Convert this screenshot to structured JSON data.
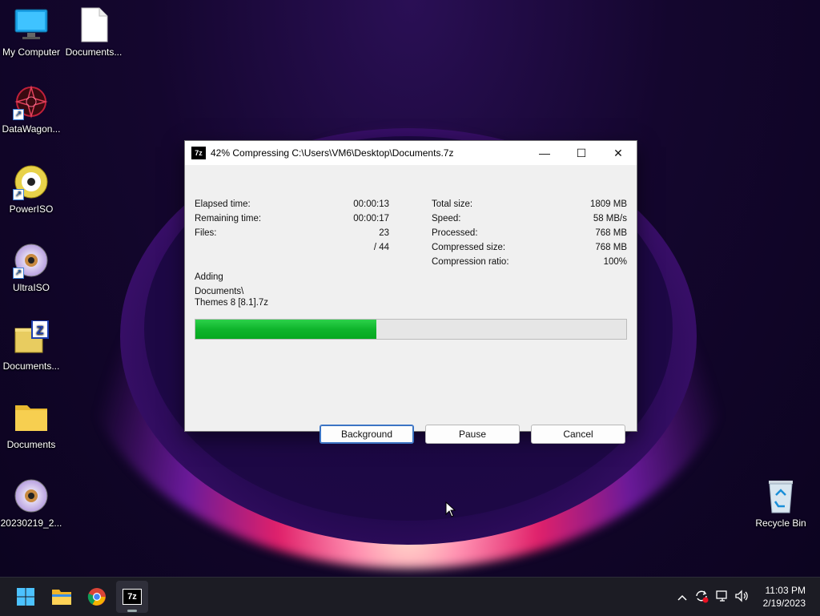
{
  "desktop": {
    "icons": [
      {
        "label": "My Computer"
      },
      {
        "label": "Documents..."
      },
      {
        "label": "DataWagon..."
      },
      {
        "label": "PowerISO"
      },
      {
        "label": "UltraISO"
      },
      {
        "label": "Documents..."
      },
      {
        "label": "Documents"
      },
      {
        "label": "20230219_2..."
      },
      {
        "label": "Recycle Bin"
      }
    ]
  },
  "dialog": {
    "app_icon": "7z",
    "title": "42% Compressing C:\\Users\\VM6\\Desktop\\Documents.7z",
    "stats_left": [
      {
        "label": "Elapsed time:",
        "value": "00:00:13"
      },
      {
        "label": "Remaining time:",
        "value": "00:00:17"
      },
      {
        "label": "Files:",
        "value": "23"
      },
      {
        "label": "",
        "value": "/ 44"
      }
    ],
    "stats_right": [
      {
        "label": "Total size:",
        "value": "1809 MB"
      },
      {
        "label": "Speed:",
        "value": "58 MB/s"
      },
      {
        "label": "Processed:",
        "value": "768 MB"
      },
      {
        "label": "Compressed size:",
        "value": "768 MB"
      },
      {
        "label": "Compression ratio:",
        "value": "100%"
      }
    ],
    "action": "Adding",
    "current_path_line1": "Documents\\",
    "current_path_line2": "Themes 8 [8.1].7z",
    "progress_percent": 42,
    "buttons": {
      "background": "Background",
      "pause": "Pause",
      "cancel": "Cancel"
    },
    "controls": {
      "minimize": "—",
      "maximize": "☐",
      "close": "✕"
    }
  },
  "taskbar": {
    "app_7z_label": "7z",
    "clock_time": "11:03 PM",
    "clock_date": "2/19/2023"
  },
  "colors": {
    "progress": "#0fb52c",
    "taskbar": "#1c1c24"
  }
}
